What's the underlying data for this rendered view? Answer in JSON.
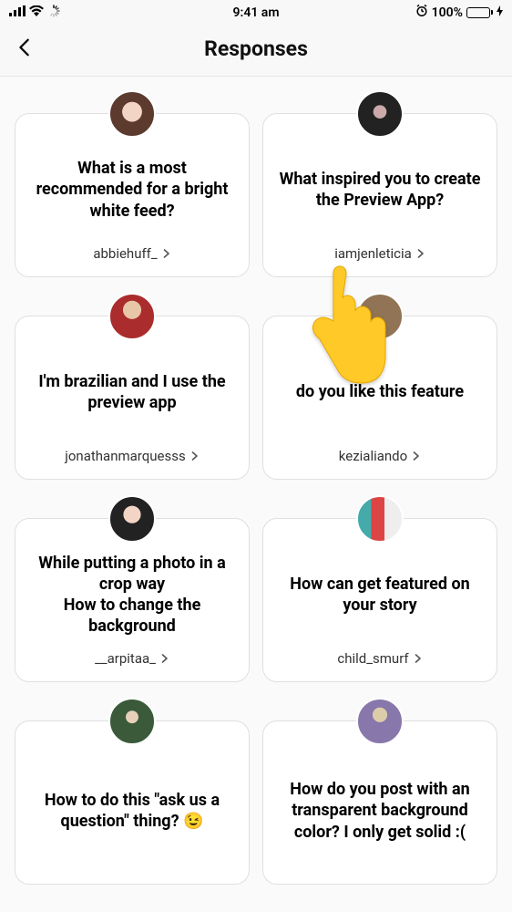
{
  "status_bar": {
    "time": "9:41 am",
    "battery_pct": "100%"
  },
  "nav": {
    "title": "Responses"
  },
  "responses": [
    {
      "question": "What is a most recommended for a bright white feed?",
      "username": "abbiehuff_",
      "avatar_class": "av-1"
    },
    {
      "question": "What inspired you to create the Preview App?",
      "username": "iamjenleticia",
      "avatar_class": "av-2"
    },
    {
      "question": "I'm brazilian and I use the preview app",
      "username": "jonathanmarquesss",
      "avatar_class": "av-3"
    },
    {
      "question": "do you like this feature",
      "username": "kezialiando",
      "avatar_class": "av-4"
    },
    {
      "question": "While putting a photo in a crop way\nHow to change the background",
      "username": "__arpitaa_",
      "avatar_class": "av-5"
    },
    {
      "question": "How can get featured on your story",
      "username": "child_smurf",
      "avatar_class": "av-6"
    },
    {
      "question": "How to do this \"ask us a question\" thing? 😉",
      "username": "",
      "avatar_class": "av-7"
    },
    {
      "question": "How do you post with an transparent background color? I only get solid :(",
      "username": "",
      "avatar_class": "av-8"
    }
  ]
}
